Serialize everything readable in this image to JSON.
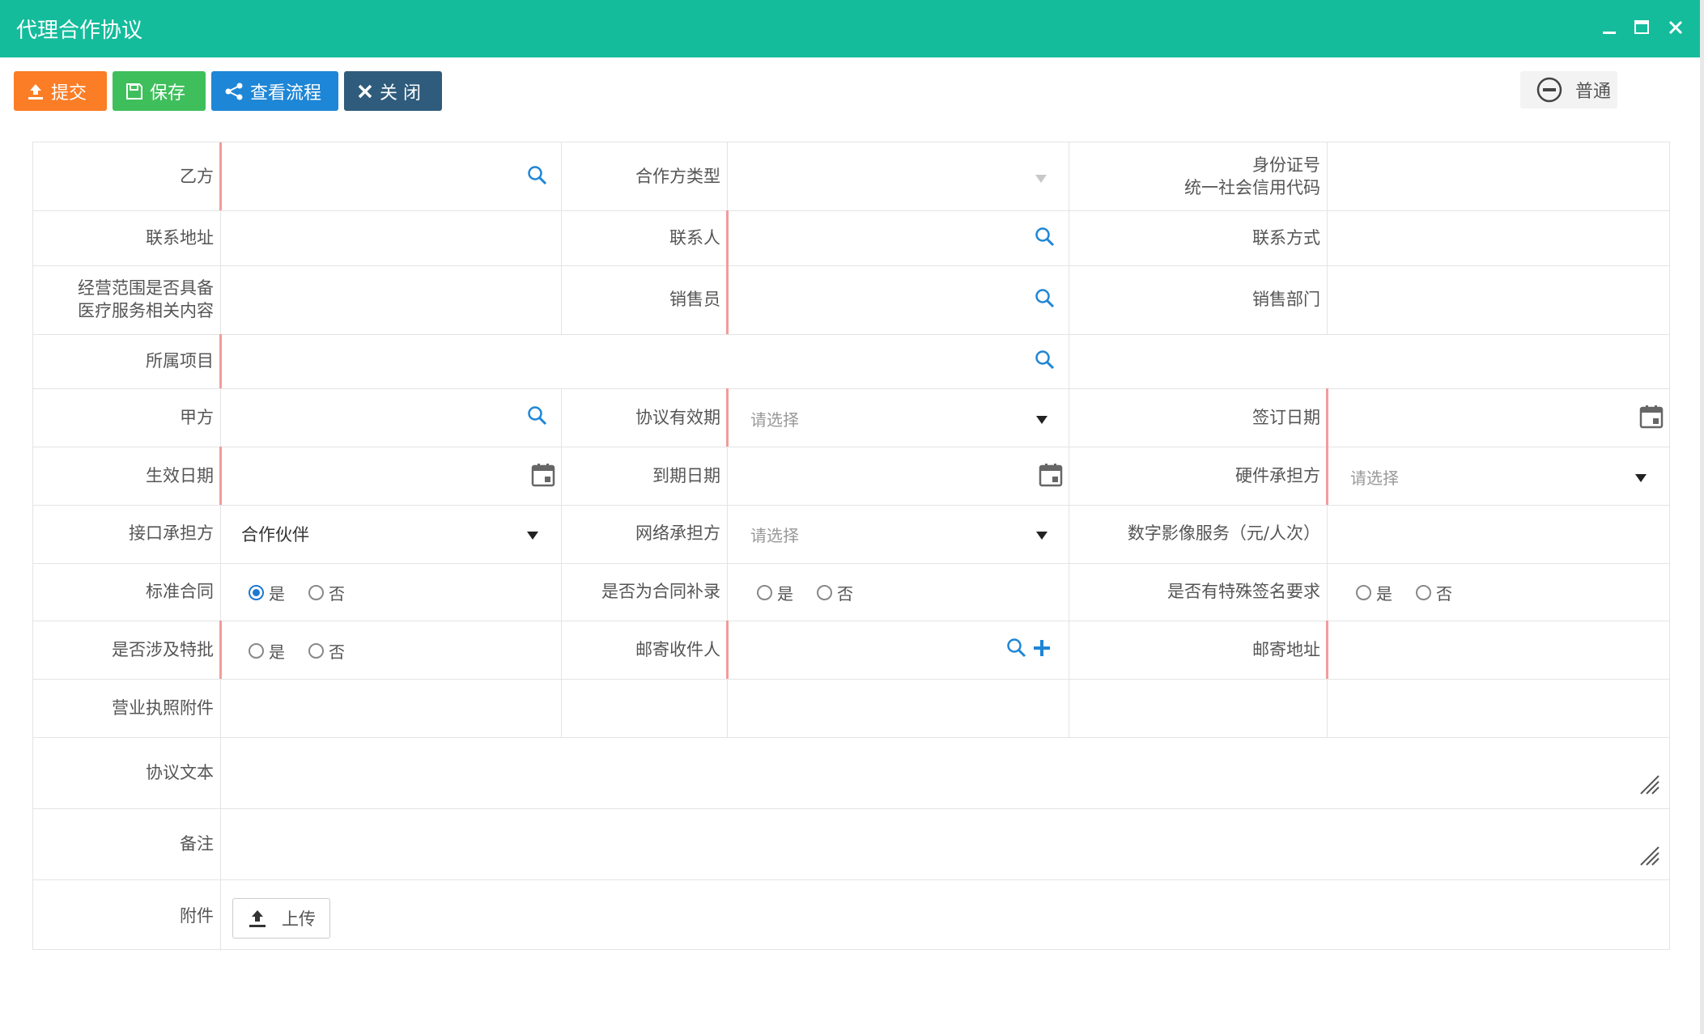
{
  "window": {
    "title": "代理合作协议"
  },
  "toolbar": {
    "submit": "提交",
    "save": "保存",
    "view_flow": "查看流程",
    "close": "关 闭"
  },
  "priority": {
    "label": "普通"
  },
  "colors": {
    "titlebar": "#14bc9c",
    "submit": "#fb7d26",
    "save": "#3fbf5c",
    "flow": "#1e86d6",
    "close": "#2f5c7c",
    "radio_active": "#1e78d0",
    "required_marker": "#f19c9c"
  },
  "form": {
    "party_b": "乙方",
    "partner_type": "合作方类型",
    "id_number_line1": "身份证号",
    "id_number_line2": "统一社会信用代码",
    "contact_address": "联系地址",
    "contact_person": "联系人",
    "contact_method": "联系方式",
    "business_scope_line1": "经营范围是否具备",
    "business_scope_line2": "医疗服务相关内容",
    "salesperson": "销售员",
    "sales_dept": "销售部门",
    "project": "所属项目",
    "party_a": "甲方",
    "validity": "协议有效期",
    "validity_placeholder": "请选择",
    "sign_date": "签订日期",
    "effective_date": "生效日期",
    "expiry_date": "到期日期",
    "hardware_bearer": "硬件承担方",
    "hardware_placeholder": "请选择",
    "interface_bearer": "接口承担方",
    "interface_value": "合作伙伴",
    "network_bearer": "网络承担方",
    "network_placeholder": "请选择",
    "digital_image": "数字影像服务（元/人次）",
    "standard_contract": "标准合同",
    "is_supplement": "是否为合同补录",
    "special_signature": "是否有特殊签名要求",
    "special_approval": "是否涉及特批",
    "mail_recipient": "邮寄收件人",
    "mail_address": "邮寄地址",
    "business_license": "营业执照附件",
    "agreement_text": "协议文本",
    "remarks": "备注",
    "attachment": "附件",
    "upload": "上传",
    "yes": "是",
    "no": "否"
  }
}
